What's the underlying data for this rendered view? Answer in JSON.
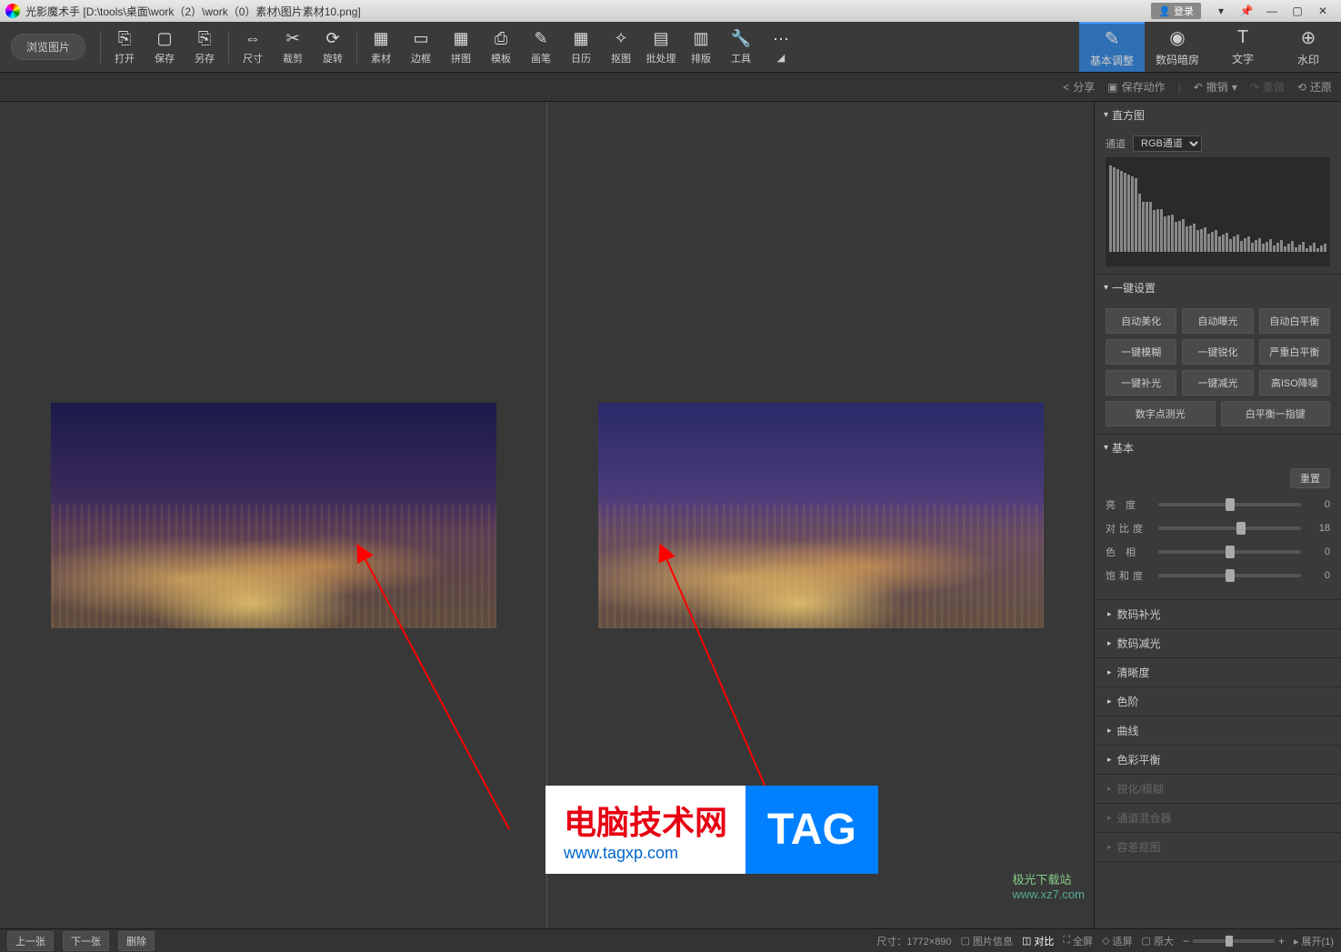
{
  "titlebar": {
    "app_name": "光影魔术手",
    "file_path": "[D:\\tools\\桌面\\work（2）\\work（0）素材\\图片素材10.png]",
    "login": "登录"
  },
  "toolbar": {
    "browse": "浏览图片",
    "tools": [
      {
        "label": "打开",
        "icon": "⎘"
      },
      {
        "label": "保存",
        "icon": "▢"
      },
      {
        "label": "另存",
        "icon": "⎘"
      },
      {
        "label": "尺寸",
        "icon": "⇔"
      },
      {
        "label": "裁剪",
        "icon": "✂"
      },
      {
        "label": "旋转",
        "icon": "⟳"
      },
      {
        "label": "素材",
        "icon": "▦"
      },
      {
        "label": "边框",
        "icon": "▭"
      },
      {
        "label": "拼图",
        "icon": "▦"
      },
      {
        "label": "模板",
        "icon": "⎙"
      },
      {
        "label": "画笔",
        "icon": "✎"
      },
      {
        "label": "日历",
        "icon": "▦"
      },
      {
        "label": "抠图",
        "icon": "✧"
      },
      {
        "label": "批处理",
        "icon": "▤"
      },
      {
        "label": "排版",
        "icon": "▥"
      },
      {
        "label": "工具",
        "icon": "🔧"
      }
    ],
    "rtabs": [
      {
        "label": "基本调整",
        "icon": "✎"
      },
      {
        "label": "数码暗房",
        "icon": "◉"
      },
      {
        "label": "文字",
        "icon": "T"
      },
      {
        "label": "水印",
        "icon": "⊕"
      }
    ]
  },
  "actionbar": {
    "share": "分享",
    "save_action": "保存动作",
    "undo": "撤销",
    "redo": "重做",
    "restore": "还原"
  },
  "rpanel": {
    "histogram_title": "直方图",
    "channel_label": "通道",
    "channel_value": "RGB通道",
    "oneclick_title": "一键设置",
    "oneclick_buttons": [
      "自动美化",
      "自动曝光",
      "自动白平衡",
      "一键模糊",
      "一键锐化",
      "严重白平衡",
      "一键补光",
      "一键减光",
      "高ISO降噪"
    ],
    "oneclick_row2": [
      "数字点测光",
      "白平衡一指键"
    ],
    "basic_title": "基本",
    "reset": "重置",
    "sliders": [
      {
        "label": "亮 度",
        "value": 0,
        "pos": 50
      },
      {
        "label": "对比度",
        "value": 18,
        "pos": 58
      },
      {
        "label": "色 相",
        "value": 0,
        "pos": 50
      },
      {
        "label": "饱和度",
        "value": 0,
        "pos": 50
      }
    ],
    "collapse": [
      "数码补光",
      "数码减光",
      "清晰度",
      "色阶",
      "曲线",
      "色彩平衡"
    ],
    "collapse_dim": [
      "锐化/模糊",
      "通道混合器",
      "容差抠图"
    ]
  },
  "bottombar": {
    "prev": "上一张",
    "next": "下一张",
    "delete": "删除",
    "size_label": "尺寸：",
    "size_value": "1772×890",
    "image_info": "图片信息",
    "compare": "对比",
    "fullscreen": "全屏",
    "fit": "适屏",
    "original": "原大",
    "expand": "展开(1)"
  },
  "watermark": {
    "t1": "电脑技术网",
    "t2": "www.tagxp.com",
    "tag": "TAG"
  },
  "site": {
    "s1": "极光下载站",
    "s2": "www.xz7.com"
  }
}
